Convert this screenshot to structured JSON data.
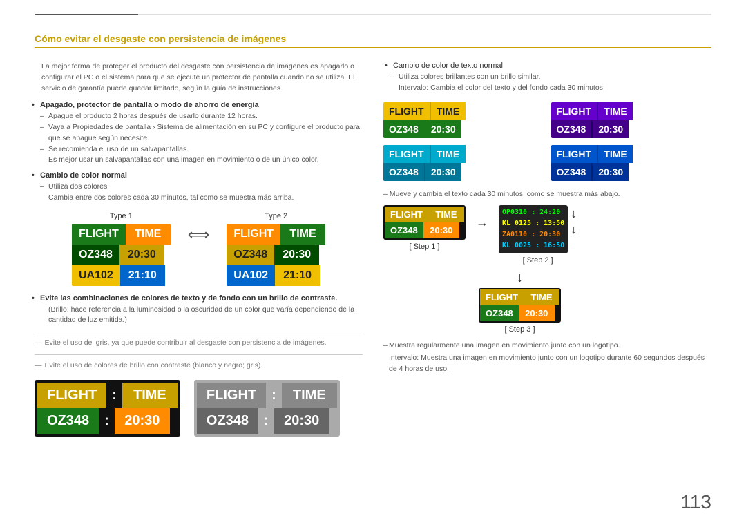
{
  "page": {
    "number": "113",
    "top_line": true
  },
  "header": {
    "title": "Cómo evitar el desgaste con persistencia de imágenes"
  },
  "left": {
    "intro": "La mejor forma de proteger el producto del desgaste con persistencia de imágenes es apagarlo o configurar el PC o el sistema para que se ejecute un protector de pantalla cuando no se utiliza. El servicio de garantía puede quedar limitado, según la guía de instrucciones.",
    "bullet1": {
      "main": "Apagado, protector de pantalla o modo de ahorro de energía",
      "sub1": "Apague el producto 2 horas después de usarlo durante 12 horas.",
      "sub2": "Vaya a Propiedades de pantalla › Sistema de alimentación en su PC y configure el producto para que se apague según necesite.",
      "sub3": "Se recomienda el uso de un salvapantallas.",
      "sub3b": "Es mejor usar un salvapantallas con una imagen en movimiento o de un único color."
    },
    "bullet2": {
      "main": "Cambio de color normal",
      "sub1": "Utiliza dos colores",
      "sub2": "Cambia entre dos colores cada 30 minutos, tal como se muestra más arriba."
    },
    "type1_label": "Type 1",
    "type2_label": "Type 2",
    "type1_board": {
      "row1": [
        "FLIGHT",
        "TIME"
      ],
      "row2": [
        "OZ348",
        "20:30"
      ],
      "row3": [
        "UA102",
        "21:10"
      ]
    },
    "type2_board": {
      "row1": [
        "FLIGHT",
        "TIME"
      ],
      "row2": [
        "OZ348",
        "20:30"
      ],
      "row3": [
        "UA102",
        "21:10"
      ]
    },
    "bullet3": {
      "main": "Evite las combinaciones de colores de texto y de fondo con un brillo de contraste.",
      "sub1": "(Brillo: hace referencia a la luminosidad o la oscuridad de un color que varía dependiendo de la cantidad de luz emitida.)"
    },
    "note1": "Evite el uso del gris, ya que puede contribuir al desgaste con persistencia de imágenes.",
    "note2": "Evite el uso de colores de brillo con contraste (blanco y negro; gris).",
    "bottom_board1": {
      "row1": [
        "FLIGHT",
        ":",
        "TIME"
      ],
      "row2": [
        "OZ348",
        ":",
        "20:30"
      ]
    },
    "bottom_board2": {
      "row1": [
        "FLIGHT",
        ":",
        "TIME"
      ],
      "row2": [
        "OZ348",
        ":",
        "20:30"
      ]
    }
  },
  "right": {
    "bullet1": {
      "main": "Cambio de color de texto normal",
      "sub1": "Utiliza colores brillantes con un brillo similar.",
      "sub2": "Intervalo: Cambia el color del texto y del fondo cada 30 minutos"
    },
    "color_samples": [
      {
        "row1": [
          "FLIGHT",
          "TIME"
        ],
        "row2": [
          "OZ348",
          "20:30"
        ]
      },
      {
        "row1": [
          "FLIGHT",
          "TIME"
        ],
        "row2": [
          "OZ348",
          "20:30"
        ]
      },
      {
        "row1": [
          "FLIGHT",
          "TIME"
        ],
        "row2": [
          "OZ348",
          "20:30"
        ]
      },
      {
        "row1": [
          "FLIGHT",
          "TIME"
        ],
        "row2": [
          "OZ348",
          "20:30"
        ]
      }
    ],
    "move_note": "– Mueve y cambia el texto cada 30 minutos, como se muestra más abajo.",
    "step1_label": "[ Step 1 ]",
    "step2_label": "[ Step 2 ]",
    "step3_label": "[ Step 3 ]",
    "step1_board": {
      "row1": [
        "FLIGHT",
        "TIME"
      ],
      "row2": [
        "OZ348",
        "20:30"
      ]
    },
    "step2_scroll": [
      "OP0310 : 24:20",
      "KL0125 : 13:50",
      "ZA0110 : 20:30",
      "KL0025 : 16:50"
    ],
    "step3_board": {
      "row1": [
        "FLIGHT",
        "TIME"
      ],
      "row2": [
        "OZ348",
        "20:30"
      ]
    },
    "bottom_note1": "Muestra regularmente una imagen en movimiento junto con un logotipo.",
    "bottom_note2": "Intervalo: Muestra una imagen en movimiento junto con un logotipo durante 60 segundos después de 4 horas de uso."
  }
}
